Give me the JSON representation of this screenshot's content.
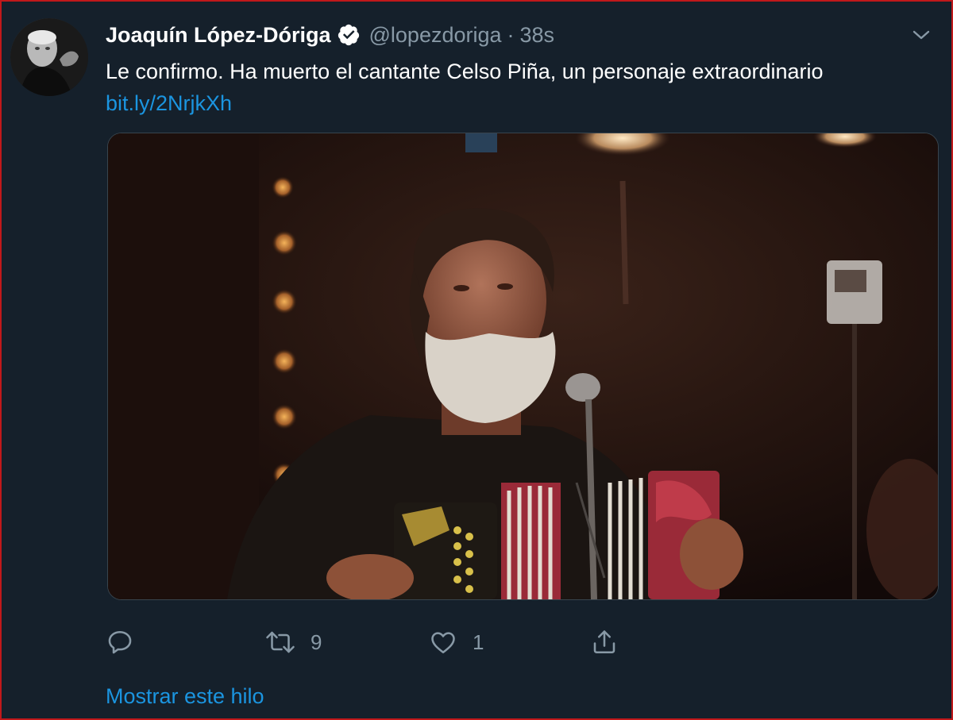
{
  "tweet": {
    "author": {
      "display_name": "Joaquín López-Dóriga",
      "handle": "@lopezdoriga",
      "verified": true
    },
    "separator": "·",
    "timestamp": "38s",
    "text": "Le confirmo. Ha muerto el cantante Celso Piña, un personaje extraordinario",
    "link": "bit.ly/2NrjkXh",
    "actions": {
      "reply_icon": "speech-bubble-icon",
      "retweet_icon": "retweet-arrows-icon",
      "retweet_count": "9",
      "like_icon": "heart-icon",
      "like_count": "1",
      "share_icon": "share-arrow-icon"
    },
    "show_thread": "Mostrar este hilo"
  },
  "colors": {
    "background": "#15202b",
    "text": "#ffffff",
    "muted": "#8899a6",
    "link": "#1b95e0",
    "border": "#c0181b"
  }
}
